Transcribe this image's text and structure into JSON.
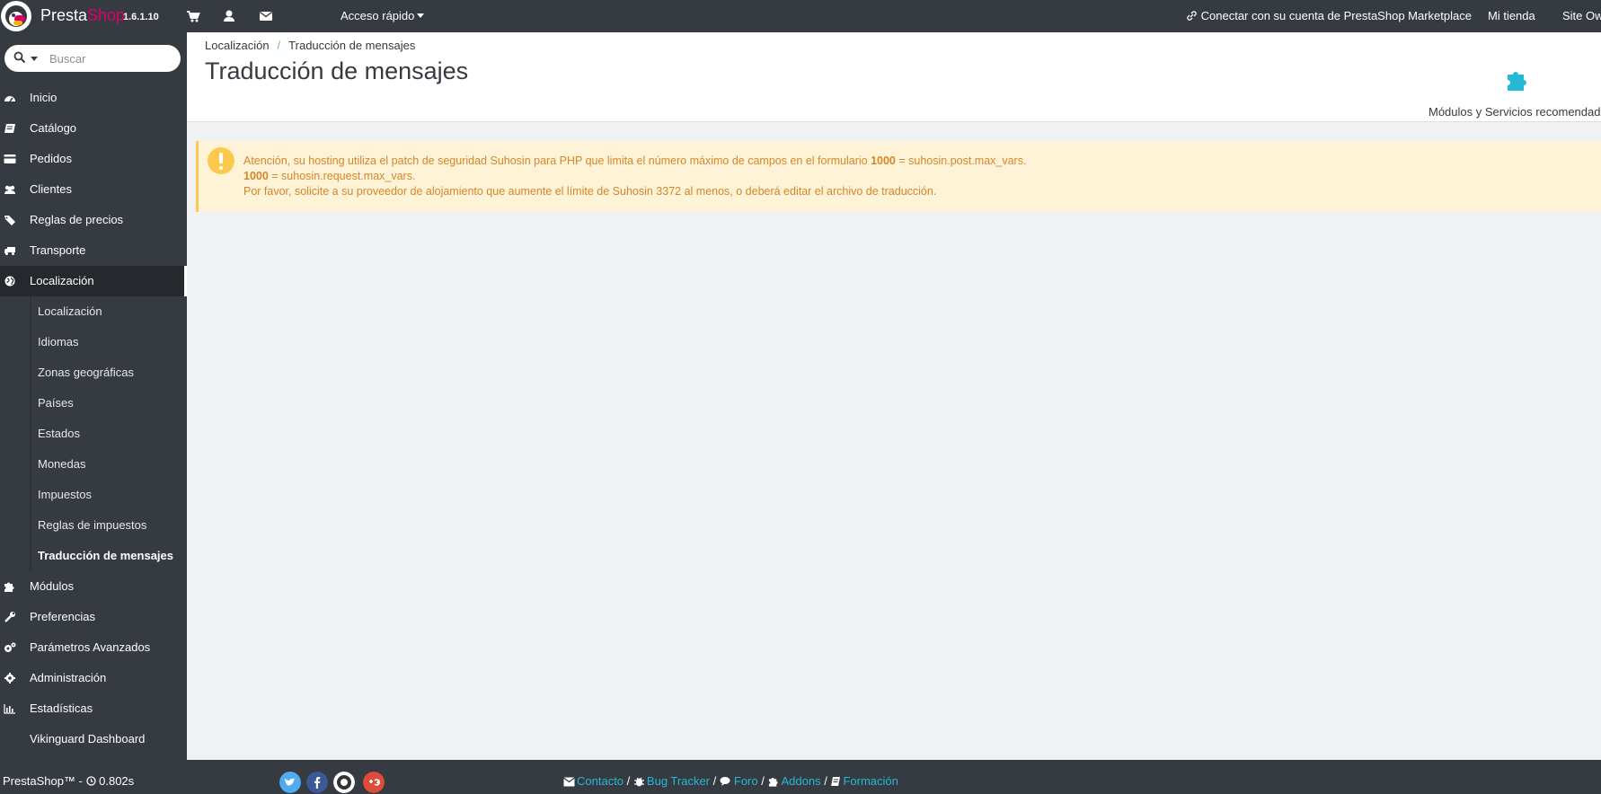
{
  "app": {
    "brand_presta": "Presta",
    "brand_shop": "Shop",
    "version": "1.6.1.10"
  },
  "topbar": {
    "quick_access": "Acceso rápido",
    "marketplace": "Conectar con su cuenta de PrestaShop Marketplace",
    "my_shop": "Mi tienda",
    "site": "Site Ow"
  },
  "search": {
    "placeholder": "Buscar"
  },
  "sidebar": {
    "items": [
      {
        "label": "Inicio",
        "icon": "dashboard-icon"
      },
      {
        "label": "Catálogo",
        "icon": "book-icon"
      },
      {
        "label": "Pedidos",
        "icon": "credit-card-icon"
      },
      {
        "label": "Clientes",
        "icon": "users-icon"
      },
      {
        "label": "Reglas de precios",
        "icon": "tags-icon"
      },
      {
        "label": "Transporte",
        "icon": "truck-icon"
      },
      {
        "label": "Localización",
        "icon": "globe-icon"
      }
    ],
    "subitems": [
      {
        "label": "Localización"
      },
      {
        "label": "Idiomas"
      },
      {
        "label": "Zonas geográficas"
      },
      {
        "label": "Países"
      },
      {
        "label": "Estados"
      },
      {
        "label": "Monedas"
      },
      {
        "label": "Impuestos"
      },
      {
        "label": "Reglas de impuestos"
      },
      {
        "label": "Traducción de mensajes"
      }
    ],
    "items_after": [
      {
        "label": "Módulos",
        "icon": "puzzle-icon"
      },
      {
        "label": "Preferencias",
        "icon": "wrench-icon"
      },
      {
        "label": "Parámetros Avanzados",
        "icon": "cogs-icon"
      },
      {
        "label": "Administración",
        "icon": "gear-icon"
      },
      {
        "label": "Estadísticas",
        "icon": "bar-chart-icon"
      },
      {
        "label": "Vikinguard Dashboard",
        "icon": ""
      }
    ]
  },
  "breadcrumb": {
    "parent": "Localización",
    "sep": "/",
    "current": "Traducción de mensajes"
  },
  "page": {
    "title": "Traducción de mensajes"
  },
  "toolbar": {
    "modules_label": "Módulos y Servicios recomendados"
  },
  "alert": {
    "line1_pre": "Atención, su hosting utiliza el patch de seguridad Suhosin para PHP que limita el número máximo de campos en el formulario ",
    "line1_num": "1000",
    "line1_post": " = suhosin.post.max_vars.",
    "line2_num": "1000",
    "line2_post": " = suhosin.request.max_vars.",
    "line3": "Por favor, solicite a su proveedor de alojamiento que aumente el límite de Suhosin 3372 al menos, o deberá editar el archivo de traducción."
  },
  "footer": {
    "info": "PrestaShop™ - ",
    "time": "0.802s",
    "contact": "Contacto",
    "bug": "Bug Tracker",
    "forum": "Foro",
    "addons": "Addons",
    "training": "Formación",
    "slash": "/"
  },
  "colors": {
    "brand_pink": "#df0067",
    "accent_blue": "#25b9d7",
    "warning": "#fcc94f",
    "dark": "#363a41"
  }
}
